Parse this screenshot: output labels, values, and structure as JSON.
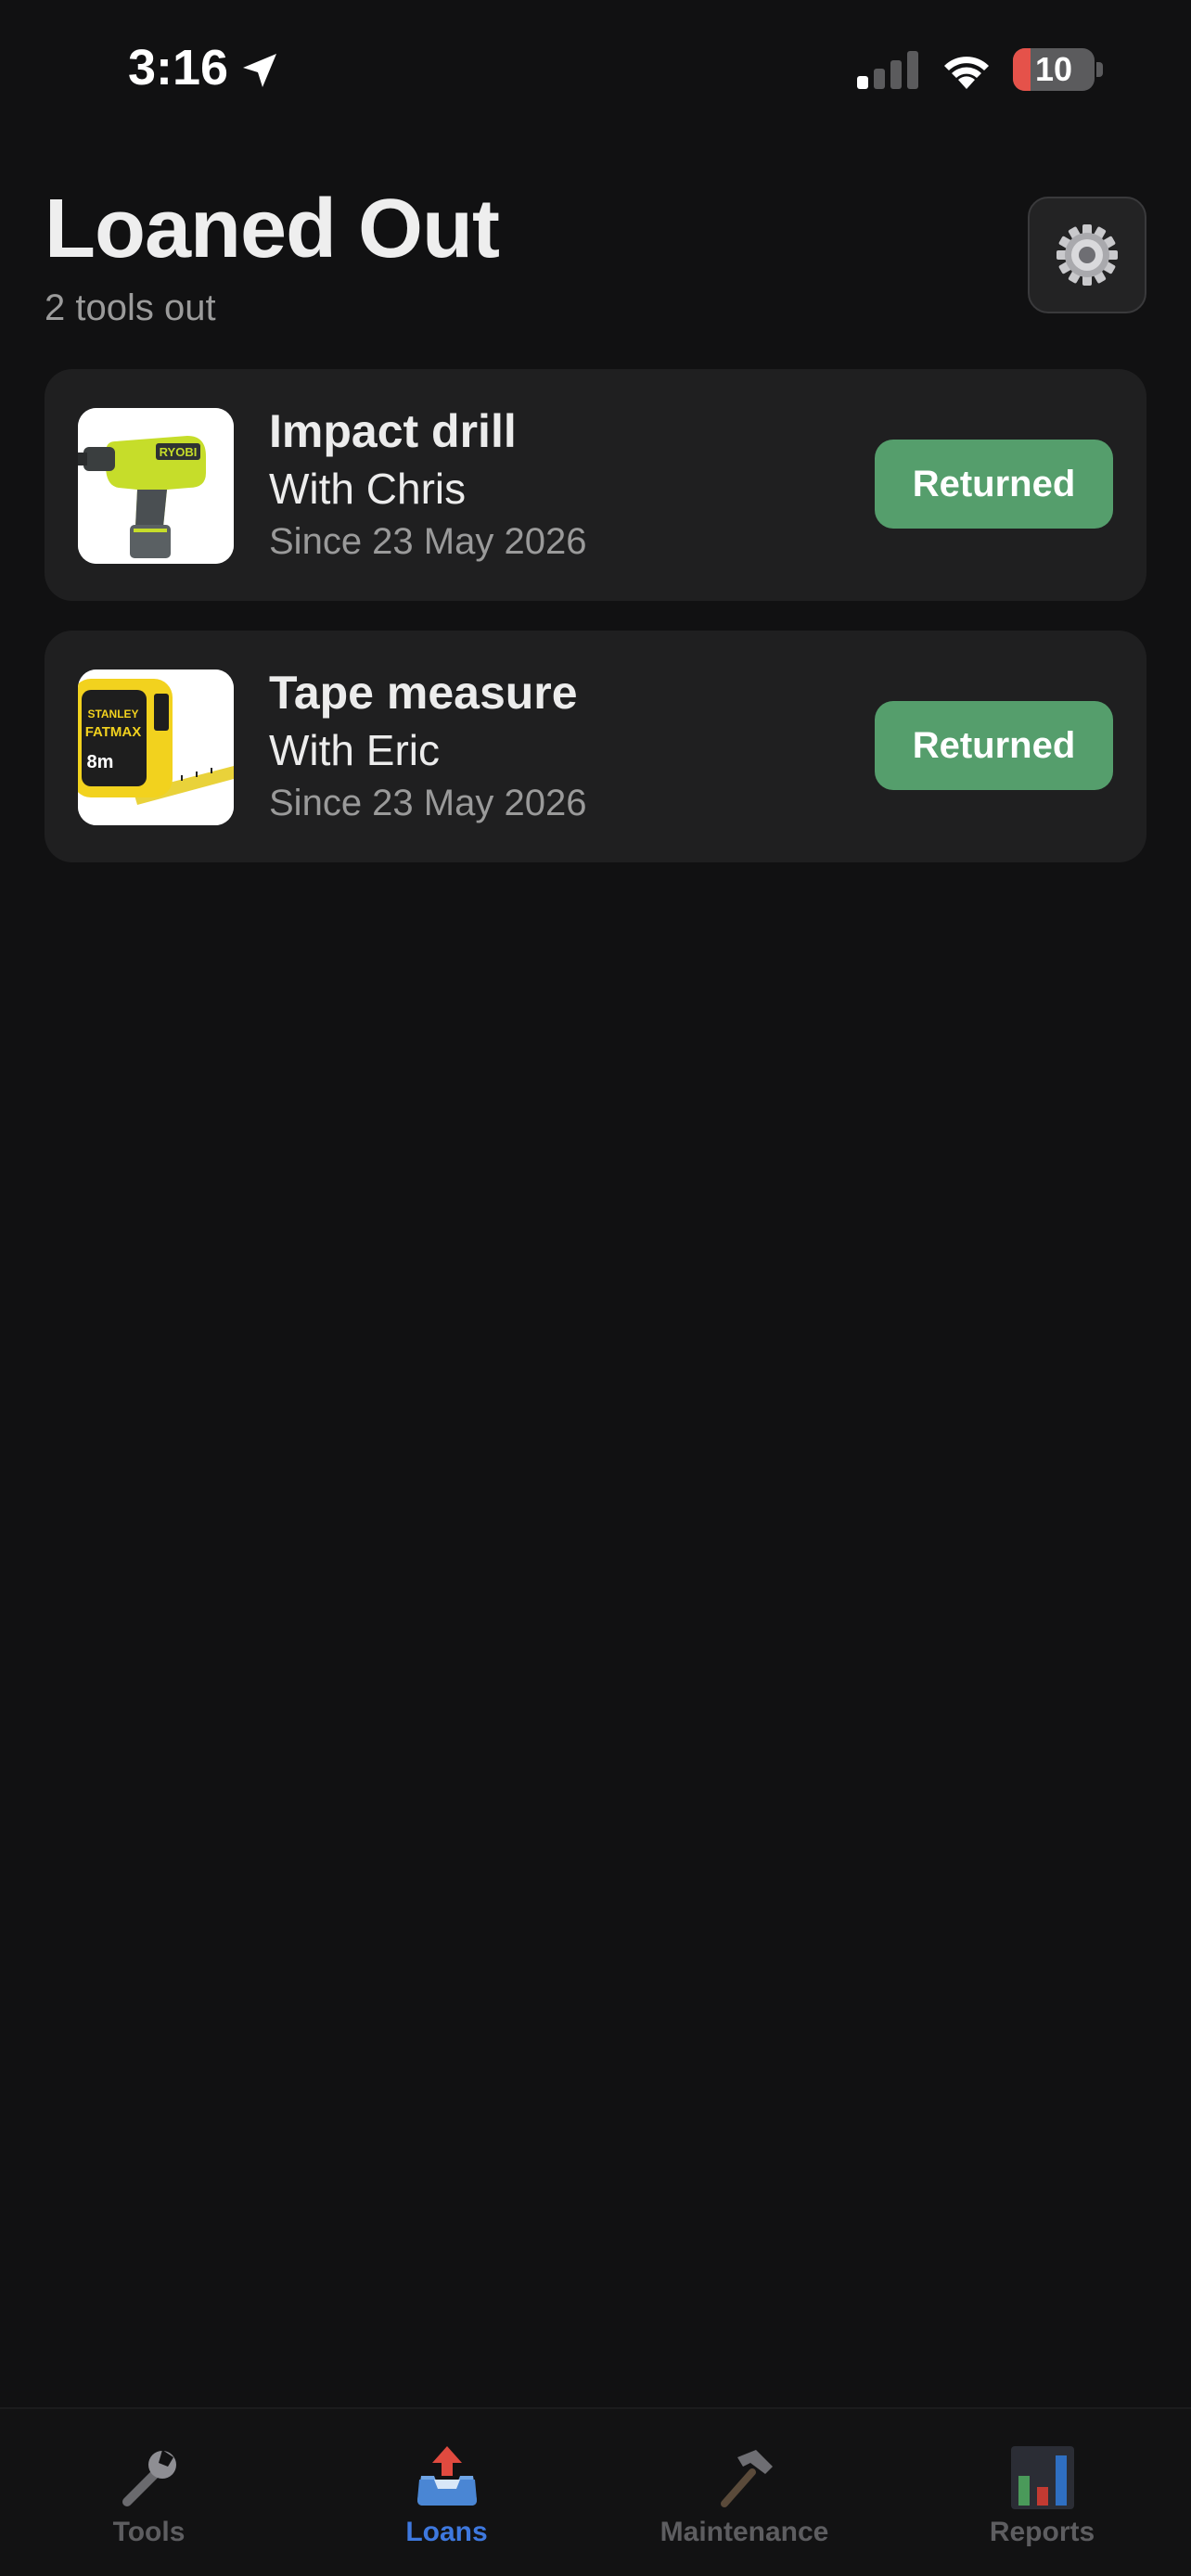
{
  "status_bar": {
    "time": "3:16",
    "battery_percent": "10",
    "battery_level": 0.1,
    "location_icon": "location-arrow-icon",
    "signal_icon": "cellular-signal-icon",
    "wifi_icon": "wifi-icon"
  },
  "header": {
    "title": "Loaned Out",
    "subtitle": "2 tools out",
    "settings_icon": "gear-icon"
  },
  "loans": [
    {
      "tool": "Impact drill",
      "borrower": "With Chris",
      "since": "Since 23 May 2026",
      "action": "Returned",
      "image": "impact-drill-image"
    },
    {
      "tool": "Tape measure",
      "borrower": "With Eric",
      "since": "Since 23 May 2026",
      "action": "Returned",
      "image": "tape-measure-image"
    }
  ],
  "tabs": [
    {
      "label": "Tools",
      "icon": "wrench-icon",
      "active": false
    },
    {
      "label": "Loans",
      "icon": "outbox-tray-icon",
      "active": true
    },
    {
      "label": "Maintenance",
      "icon": "hammer-icon",
      "active": false
    },
    {
      "label": "Reports",
      "icon": "bar-chart-icon",
      "active": false
    }
  ],
  "colors": {
    "background": "#111112",
    "card": "#1f1f20",
    "returned_button": "#559e6c",
    "active_tab": "#3e78de",
    "inactive_tab": "#5d5d60",
    "battery_low": "#e5524a"
  }
}
